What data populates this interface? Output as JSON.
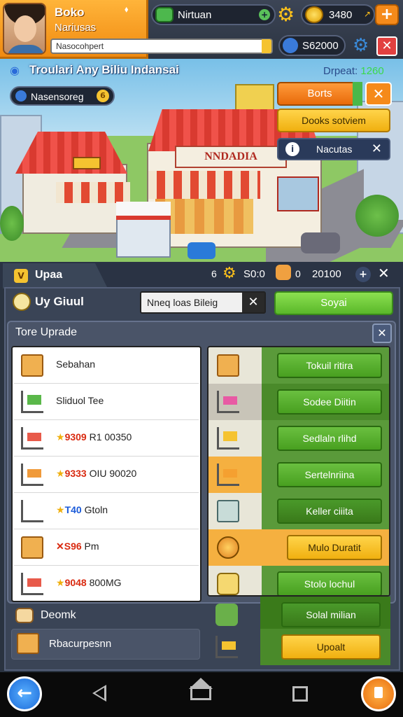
{
  "profile": {
    "name": "Boko",
    "subtitle": "Nariusas",
    "input_value": "Nasocohpert",
    "edit_icon": "pin-icon"
  },
  "currencies": {
    "cash_label": "Nirtuan",
    "coins": "3480",
    "gems": "S62000"
  },
  "scene": {
    "title": "Troulari Any Biliu Indansai",
    "score_label": "Drpeat:",
    "score_value": "1260",
    "location": "Nasensoreg",
    "location_badge": "6",
    "store_sign": "NNDADIA",
    "boost_label": "Borts",
    "booster_label": "Dooks sotviem",
    "notice_label": "Nacutas"
  },
  "panel": {
    "tab_label": "Upaa",
    "tab_badge": "V",
    "stat_gear": "6",
    "stat_value_1": "S0:0",
    "stat_bag": "0",
    "stat_value_2": "20100",
    "category": "Uy Giuul",
    "search_value": "Nneq loas Bileig",
    "save_label": "Soyai",
    "upgrade_title": "Tore Uprade",
    "deck_label": "Deomk",
    "resources_label": "Rbacurpesnn"
  },
  "left_items": [
    {
      "icon": "box-icon",
      "prefix": "",
      "highlight": "",
      "text": "Sebahan"
    },
    {
      "icon": "produce-cart-icon",
      "prefix": "",
      "highlight": "",
      "text": "Sliduol Tee"
    },
    {
      "icon": "cart-icon",
      "prefix": "★",
      "highlight": "9309",
      "text": " R1 00350"
    },
    {
      "icon": "cart-icon",
      "prefix": "★",
      "highlight": "9333",
      "text": " OIU 90020"
    },
    {
      "icon": "cart-icon",
      "prefix": "★",
      "highlight": "T40",
      "text": " Gtoln"
    },
    {
      "icon": "box-icon",
      "prefix": "✕",
      "highlight": "S96",
      "text": " Pm"
    },
    {
      "icon": "cart-icon",
      "prefix": "★",
      "highlight": "9048",
      "text": " 800MG"
    }
  ],
  "right_items": [
    {
      "icon": "box-icon",
      "label": "Tokuil ritira",
      "style": "green"
    },
    {
      "icon": "cart-icon",
      "label": "Sodee Diitin",
      "style": "green"
    },
    {
      "icon": "produce-cart-icon",
      "label": "Sedlaln rlihd",
      "style": "green"
    },
    {
      "icon": "cart-icon",
      "label": "Sertelnriina",
      "style": "green"
    },
    {
      "icon": "fridge-icon",
      "label": "Keller ciiita",
      "style": "green"
    },
    {
      "icon": "coin-bag-icon",
      "label": "Mulo Duratit",
      "style": "gold"
    },
    {
      "icon": "cheese-icon",
      "label": "Stolo lochul",
      "style": "green"
    }
  ],
  "bottom_actions": {
    "sell_label": "Solal milian",
    "upgrade_label": "Upoalt"
  },
  "colors": {
    "accent_orange": "#f58a1a",
    "accent_green": "#5ab82a",
    "accent_gold": "#f0b010",
    "panel_bg": "#3a4456"
  }
}
